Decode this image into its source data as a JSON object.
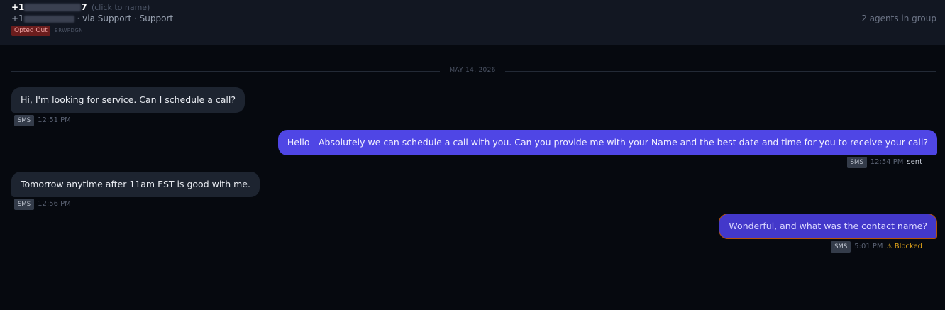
{
  "header": {
    "phone_prefix": "+1",
    "phone_suffix": "7",
    "click_hint": "(click to name)",
    "via_prefix": "+1",
    "via_text": "· via Support · Support",
    "opt_status": "Opted Out",
    "code": "BRWPDGN",
    "agents_text": "2 agents in group"
  },
  "date_divider": "MAY 14, 2026",
  "messages": [
    {
      "direction": "in",
      "text": "Hi, I'm looking for service. Can I schedule a call?",
      "channel": "SMS",
      "time": "12:51 PM",
      "status": ""
    },
    {
      "direction": "out",
      "text": "Hello - Absolutely we can schedule a call with you. Can you provide me with your Name and the best date and time for you to receive your call?",
      "channel": "SMS",
      "time": "12:54 PM",
      "status": "sent"
    },
    {
      "direction": "in",
      "text": "Tomorrow anytime after 11am EST is good with me.",
      "channel": "SMS",
      "time": "12:56 PM",
      "status": ""
    },
    {
      "direction": "out",
      "text": "Wonderful, and what was the contact name?",
      "channel": "SMS",
      "time": "5:01 PM",
      "status": "Blocked"
    }
  ],
  "colors": {
    "outgoing_bubble": "#4f46e5",
    "incoming_bubble": "#1d2430",
    "opted_out_badge": "#6b1d1d",
    "blocked_warning": "#e5a619"
  }
}
